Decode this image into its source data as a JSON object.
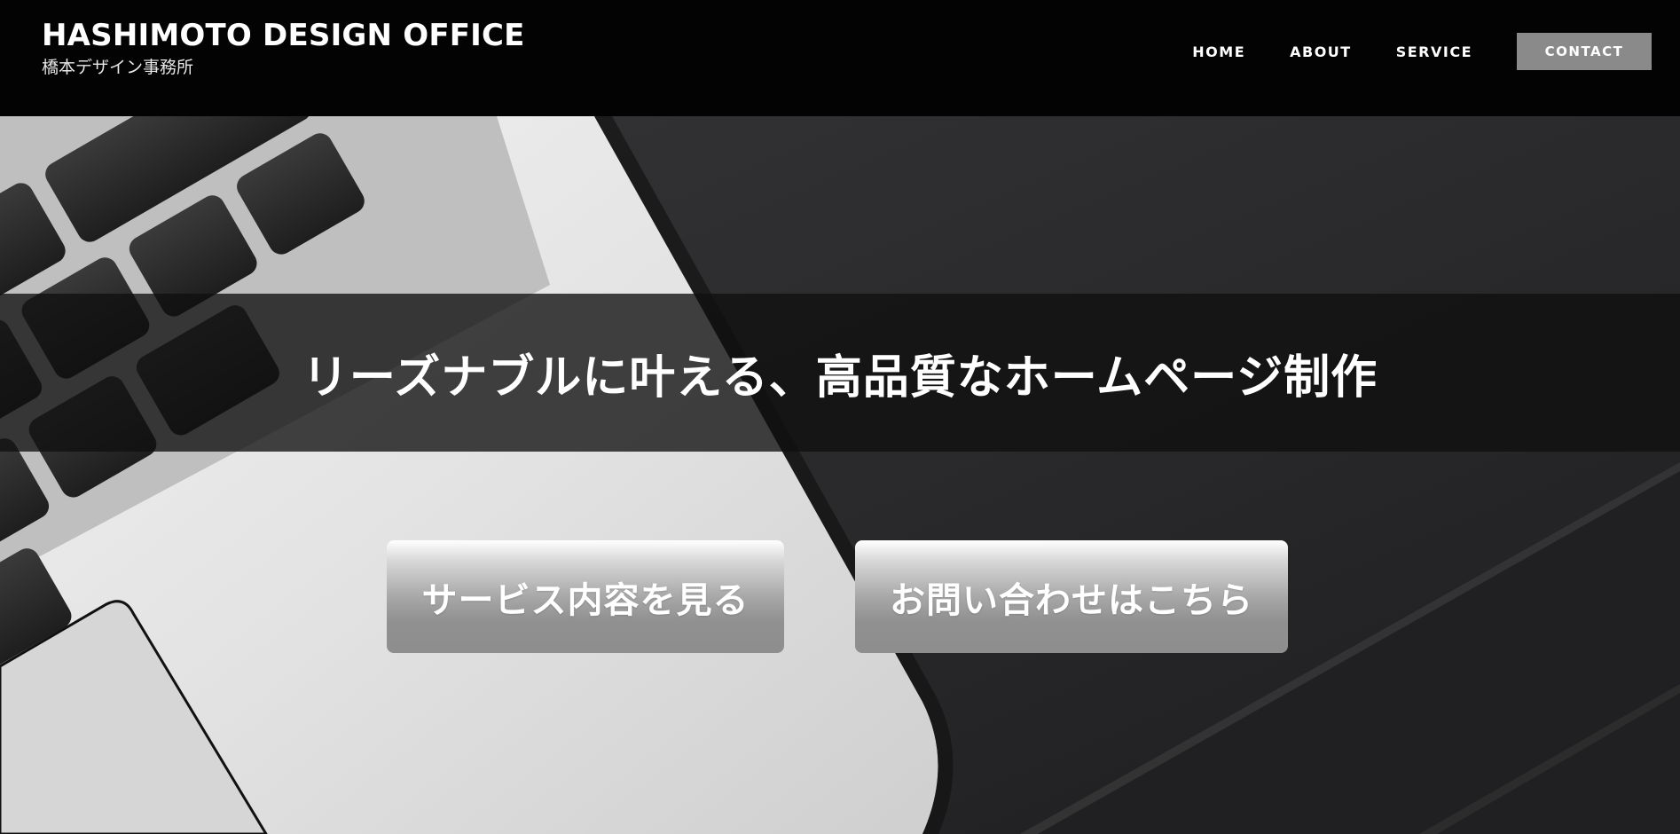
{
  "header": {
    "brand_title": "HASHIMOTO DESIGN OFFICE",
    "brand_subtitle": "橋本デザイン事務所",
    "nav": {
      "home": "HOME",
      "about": "ABOUT",
      "service": "SERVICE",
      "contact": "CONTACT"
    }
  },
  "hero": {
    "tagline": "リーズナブルに叶える、高品質なホームページ制作",
    "buttons": {
      "service": "サービス内容を見る",
      "contact": "お問い合わせはこちら"
    }
  },
  "colors": {
    "header_bg": "#030303",
    "contact_button_bg": "#8a8a8a",
    "tagline_band_bg": "#101010",
    "hero_bg": "#2a2a2c"
  },
  "icons": [
    "laptop-keyboard-image"
  ]
}
